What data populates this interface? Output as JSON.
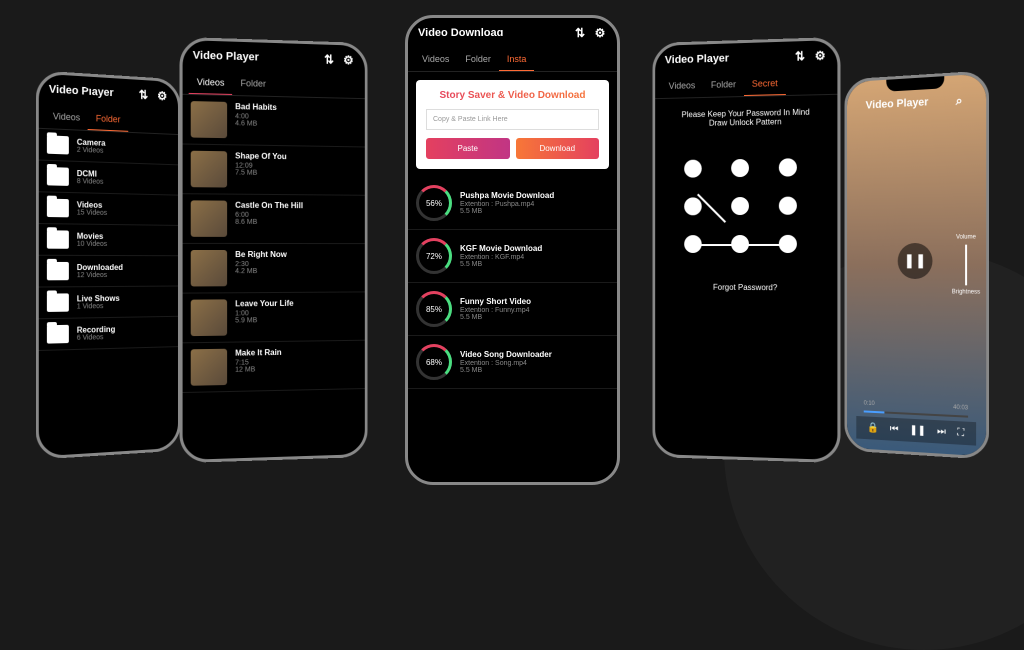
{
  "phone1": {
    "title": "Video Player",
    "tabs": [
      "Videos",
      "Folder"
    ],
    "folders": [
      {
        "name": "Camera",
        "count": "2 Videos"
      },
      {
        "name": "DCMI",
        "count": "8 Videos"
      },
      {
        "name": "Videos",
        "count": "15 Videos"
      },
      {
        "name": "Movies",
        "count": "10 Videos"
      },
      {
        "name": "Downloaded",
        "count": "12 Videos"
      },
      {
        "name": "Live Shows",
        "count": "1 Videos"
      },
      {
        "name": "Recording",
        "count": "6 Videos"
      }
    ]
  },
  "phone2": {
    "title": "Video Player",
    "tabs": [
      "Videos",
      "Folder"
    ],
    "videos": [
      {
        "name": "Bad Habits",
        "duration": "4:00",
        "size": "4.6 MB"
      },
      {
        "name": "Shape Of You",
        "duration": "12:09",
        "size": "7.5 MB"
      },
      {
        "name": "Castle On The Hill",
        "duration": "6:00",
        "size": "8.6 MB"
      },
      {
        "name": "Be Right Now",
        "duration": "2:30",
        "size": "4.2 MB"
      },
      {
        "name": "Leave Your Life",
        "duration": "1:00",
        "size": "5.9 MB"
      },
      {
        "name": "Make It Rain",
        "duration": "7:15",
        "size": "12 MB"
      }
    ]
  },
  "phone3": {
    "title": "Video Download",
    "tabs": [
      "Videos",
      "Folder",
      "Insta"
    ],
    "insta": {
      "heading": "Story Saver & Video Download",
      "placeholder": "Copy & Paste Link Here",
      "paste": "Paste",
      "download": "Download"
    },
    "downloads": [
      {
        "pct": "56%",
        "name": "Pushpa Movie Download",
        "ext": "Extention : Pushpa.mp4",
        "size": "5.5 MB"
      },
      {
        "pct": "72%",
        "name": "KGF Movie Download",
        "ext": "Extention : KGF.mp4",
        "size": "5.5 MB"
      },
      {
        "pct": "85%",
        "name": "Funny Short Video",
        "ext": "Extention : Funny.mp4",
        "size": "5.5 MB"
      },
      {
        "pct": "68%",
        "name": "Video Song Downloader",
        "ext": "Extention : Song.mp4",
        "size": "5.5 MB"
      }
    ]
  },
  "phone4": {
    "title": "Video Player",
    "tabs": [
      "Videos",
      "Folder",
      "Secret"
    ],
    "message": "Please Keep Your Password In Mind\nDraw Unlock Pattern",
    "msg1": "Please Keep Your Password In Mind",
    "msg2": "Draw Unlock Pattern",
    "forgot": "Forgot Password?"
  },
  "phone5": {
    "title": "Video Player",
    "volume": "Volume",
    "brightness": "Brightness",
    "time_current": "0:10",
    "time_total": "40:03"
  }
}
